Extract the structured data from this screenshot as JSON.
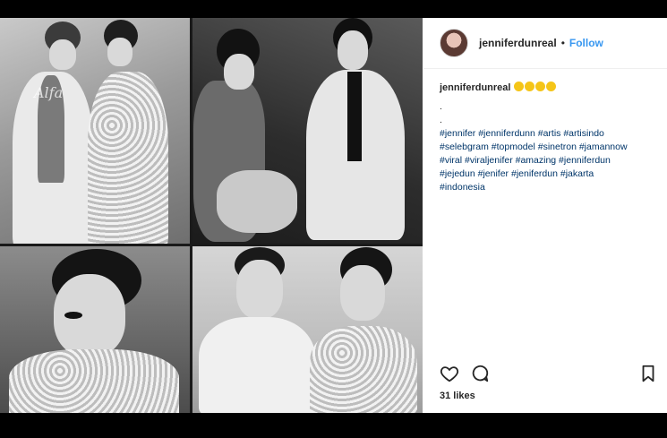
{
  "post": {
    "username": "jenniferdunreal",
    "dot": "•",
    "follow_label": "Follow",
    "watermark": "Alfa",
    "caption": {
      "username": "jenniferdunreal",
      "emojis": [
        "grin-emoji",
        "grin-emoji",
        "grin-emoji",
        "grin-emoji"
      ],
      "lines": [
        ".",
        "."
      ],
      "hashtags": [
        "#jennifer #jenniferdunn #artis #artisindo",
        "#selebgram #topmodel #sinetron #jamannow",
        "#viral #viraljenifer #amazing #jenniferdun",
        "#jejedun #jenifer #jeniferdun #jakarta",
        "#indonesia"
      ]
    },
    "likes": "31 likes",
    "icons": {
      "like": "heart-icon",
      "comment": "comment-icon",
      "save": "bookmark-icon"
    }
  }
}
